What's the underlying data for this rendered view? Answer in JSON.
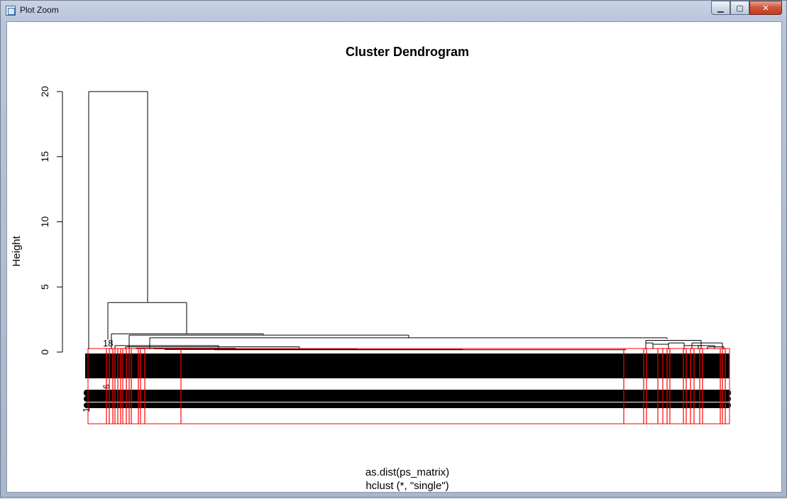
{
  "window": {
    "title": "Plot Zoom",
    "min_symbol": "▁",
    "max_symbol": "▢",
    "close_symbol": "✕"
  },
  "chart_data": {
    "type": "dendrogram",
    "title": "Cluster Dendrogram",
    "ylabel": "Height",
    "xlabel": "as.dist(ps_matrix)",
    "sub": "hclust (*, \"single\")",
    "ylim": [
      0,
      20
    ],
    "yticks": [
      0,
      5,
      10,
      15,
      20
    ],
    "leaf_label_fragments": [
      "1",
      "8",
      "6"
    ],
    "merges": [
      {
        "height": 20.0
      },
      {
        "height": 3.8
      },
      {
        "height": 1.4
      },
      {
        "height": 1.3
      },
      {
        "height": 1.1
      },
      {
        "height": 1.0
      },
      {
        "height": 0.9
      },
      {
        "height": 0.7
      },
      {
        "height": 0.6
      },
      {
        "height": 0.5
      },
      {
        "height": 0.4
      },
      {
        "height": 0.3
      }
    ],
    "rect_hclust_color": "#ff0000",
    "line_color": "#000000"
  }
}
